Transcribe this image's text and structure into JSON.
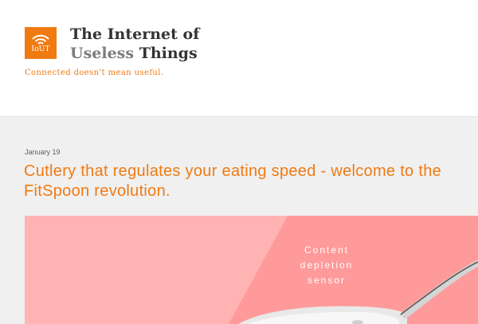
{
  "site": {
    "logo_text": "IoUT",
    "title_line1": "The Internet of",
    "title_line2_word1": "Useless",
    "title_line2_word2": "Things",
    "tagline": "Connected doesn't mean useful."
  },
  "post": {
    "date": "January 19",
    "title": "Cutlery that regulates your eating speed - welcome to the FitSpoon revolution.",
    "image": {
      "label_lines": [
        "Content",
        "depletion",
        "sensor"
      ]
    }
  },
  "colors": {
    "accent": "#f07a12",
    "image_pink_light": "#ffb3b3",
    "image_pink": "#ff9a9a"
  },
  "icons": {
    "logo": "wifi-icon"
  }
}
